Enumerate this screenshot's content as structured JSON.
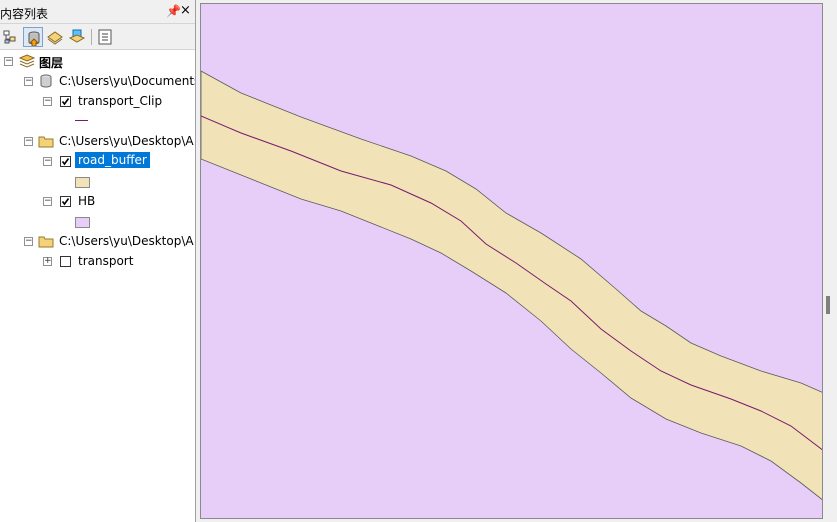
{
  "toc": {
    "title": "内容列表",
    "pin_label": "ᵖ",
    "close_label": "×",
    "toolbar": [
      {
        "name": "list-by-drawing-order-icon",
        "active": false
      },
      {
        "name": "list-by-source-icon",
        "active": true
      },
      {
        "name": "list-by-visibility-icon",
        "active": false
      },
      {
        "name": "list-by-selection-icon",
        "active": false
      },
      {
        "name": "options-icon",
        "active": false
      }
    ],
    "root_label": "图层",
    "groups": [
      {
        "path": "C:\\Users\\yu\\Documents",
        "icon": "database-icon"
      },
      {
        "path": "C:\\Users\\yu\\Desktop\\A",
        "icon": "folder-icon"
      },
      {
        "path": "C:\\Users\\yu\\Desktop\\A",
        "icon": "folder-icon"
      }
    ],
    "layers": [
      {
        "label": "transport_Clip",
        "checked": true,
        "symbol": "line",
        "color": "#7a1a6b"
      },
      {
        "label": "road_buffer",
        "checked": true,
        "symbol": "fill",
        "color": "#f1e2b8",
        "selected": true
      },
      {
        "label": "HB",
        "checked": true,
        "symbol": "fill",
        "color": "#e6cef8"
      },
      {
        "label": "transport",
        "checked": false,
        "collapsed": true
      }
    ]
  },
  "map": {
    "background_color": "#e6cef8",
    "buffer_color": "#f1e2b8",
    "road_color": "#7a1a6b"
  }
}
